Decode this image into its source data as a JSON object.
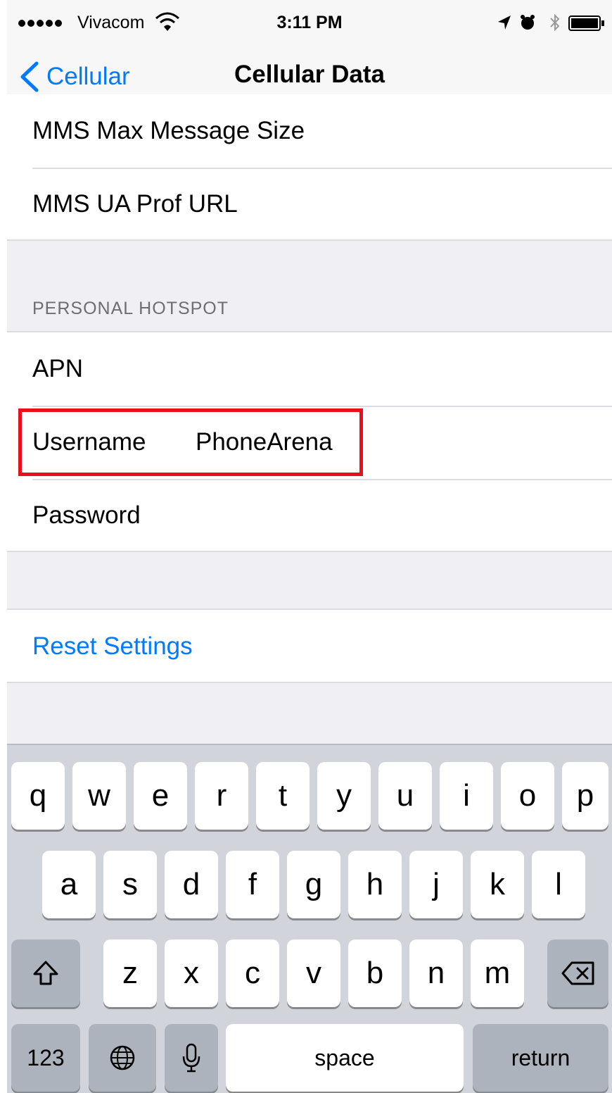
{
  "status_bar": {
    "carrier": "Vivacom",
    "time": "3:11 PM",
    "icons": [
      "signal-dots-icon",
      "wifi-icon",
      "location-icon",
      "alarm-icon",
      "bluetooth-icon",
      "battery-icon"
    ]
  },
  "nav": {
    "back_label": "Cellular",
    "title": "Cellular Data",
    "back_icon": "chevron-left-icon"
  },
  "mms_group": {
    "rows": [
      {
        "label": "MMS Max Message Size"
      },
      {
        "label": "MMS UA Prof URL"
      }
    ]
  },
  "hotspot_group": {
    "header": "PERSONAL HOTSPOT",
    "rows": [
      {
        "label": "APN",
        "value": ""
      },
      {
        "label": "Username",
        "value": "PhoneArena"
      },
      {
        "label": "Password",
        "value": ""
      }
    ]
  },
  "reset": {
    "label": "Reset Settings"
  },
  "keyboard": {
    "row1": [
      "q",
      "w",
      "e",
      "r",
      "t",
      "y",
      "u",
      "i",
      "o",
      "p"
    ],
    "row2": [
      "a",
      "s",
      "d",
      "f",
      "g",
      "h",
      "j",
      "k",
      "l"
    ],
    "row3": [
      "z",
      "x",
      "c",
      "v",
      "b",
      "n",
      "m"
    ],
    "numbers_key": "123",
    "space_key": "space",
    "return_key": "return",
    "icons": [
      "shift-icon",
      "backspace-icon",
      "globe-icon",
      "microphone-icon"
    ]
  },
  "colors": {
    "accent": "#007aff",
    "highlight": "#e8101c",
    "group_background": "#efeff4",
    "keyboard_background": "#d1d5db"
  }
}
